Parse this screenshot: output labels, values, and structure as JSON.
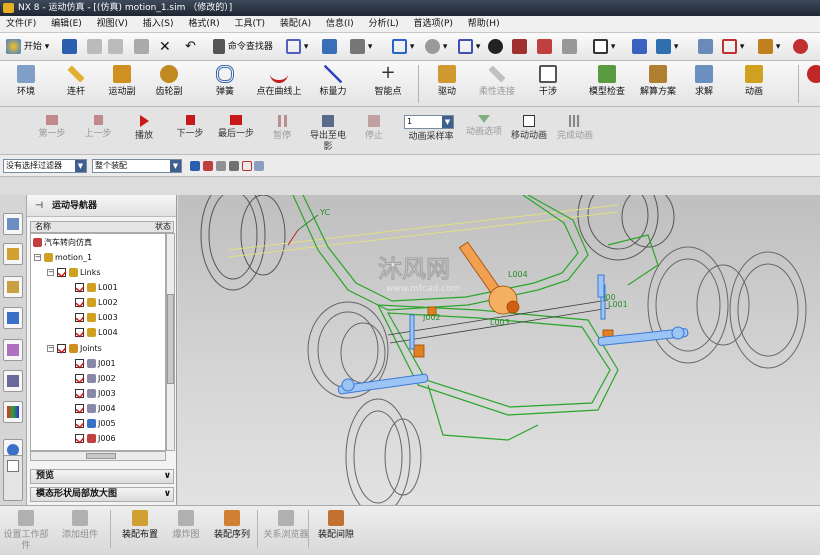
{
  "window": {
    "title": "NX 8 - 运动仿真 - [(仿真) motion_1.sim （修改的）]"
  },
  "menu": [
    "文件(F)",
    "编辑(E)",
    "视图(V)",
    "插入(S)",
    "格式(R)",
    "工具(T)",
    "装配(A)",
    "信息(I)",
    "分析(L)",
    "首选项(P)",
    "帮助(H)"
  ],
  "standard_toolbar": {
    "start_label": "开始",
    "command_finder_label": "命令查找器"
  },
  "ribbon": {
    "buttons": [
      "环境",
      "连杆",
      "运动副",
      "齿轮副",
      "弹簧",
      "点在曲线上",
      "标量力",
      "智能点",
      "驱动",
      "柔性连接",
      "干涉",
      "模型检查",
      "解算方案",
      "求解",
      "动画"
    ]
  },
  "animation_toolbar": {
    "buttons": [
      "第一步",
      "上一步",
      "播放",
      "下一步",
      "最后一步",
      "暂停",
      "导出至电影",
      "停止"
    ],
    "rate_value": "1",
    "rate_label": "动画采样率",
    "options": [
      "动画选项",
      "移动动画",
      "完成动画"
    ]
  },
  "filter_bar": {
    "filter_value": "没有选择过滤器",
    "scope_value": "整个装配"
  },
  "navigator": {
    "title": "运动导航器",
    "col_name": "名称",
    "col_status": "状态",
    "tree": [
      {
        "label": "汽车转向仿真",
        "level": 0
      },
      {
        "label": "motion_1",
        "level": 1
      },
      {
        "label": "Links",
        "level": 2
      },
      {
        "label": "L001",
        "level": 3
      },
      {
        "label": "L002",
        "level": 3
      },
      {
        "label": "L003",
        "level": 3
      },
      {
        "label": "L004",
        "level": 3
      },
      {
        "label": "Joints",
        "level": 2
      },
      {
        "label": "J001",
        "level": 3
      },
      {
        "label": "J002",
        "level": 3
      },
      {
        "label": "J003",
        "level": 3
      },
      {
        "label": "J004",
        "level": 3
      },
      {
        "label": "J005",
        "level": 3
      },
      {
        "label": "J006",
        "level": 3
      }
    ],
    "preview_label": "预览",
    "diagram_label": "模态形状局部放大图"
  },
  "viewport": {
    "watermark_main": "沐风网",
    "watermark_url": "www.mfcad.com",
    "axis_label": "YC",
    "labels": [
      "L004",
      "L001",
      "J002",
      "L003",
      "J00"
    ]
  },
  "bottom_toolbar": {
    "buttons": [
      "设置工作部件",
      "添加组件",
      "装配布置",
      "爆炸图",
      "装配序列",
      "关系浏览器",
      "装配间隙"
    ]
  },
  "colors": {
    "link_green": "#2aa52a",
    "orange_part": "#e07a20",
    "blue_part": "#3b78d8",
    "wire": "#555555"
  }
}
